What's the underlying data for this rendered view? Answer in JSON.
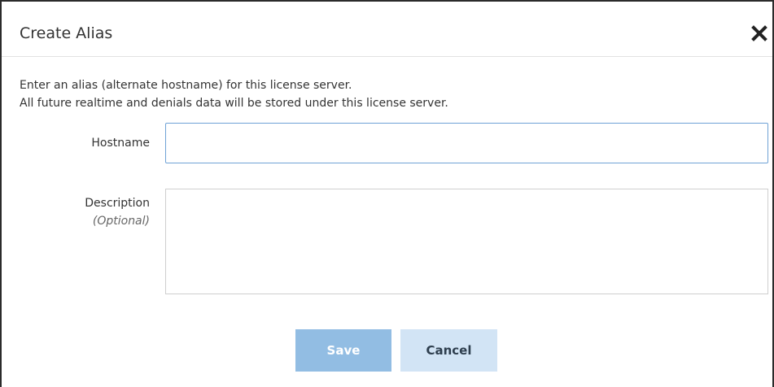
{
  "dialog": {
    "title": "Create Alias",
    "close_icon": "close-icon",
    "intro_line_1": "Enter an alias (alternate hostname) for this license server.",
    "intro_line_2": "All future realtime and denials data will be stored under this license server."
  },
  "form": {
    "hostname": {
      "label": "Hostname",
      "value": "",
      "placeholder": ""
    },
    "description": {
      "label": "Description",
      "optional_text": "(Optional)",
      "value": "",
      "placeholder": ""
    }
  },
  "actions": {
    "save_label": "Save",
    "cancel_label": "Cancel"
  },
  "colors": {
    "save_button_bg": "#92bde3",
    "cancel_button_bg": "#d2e4f5",
    "focused_input_border": "#6fa2d6"
  }
}
